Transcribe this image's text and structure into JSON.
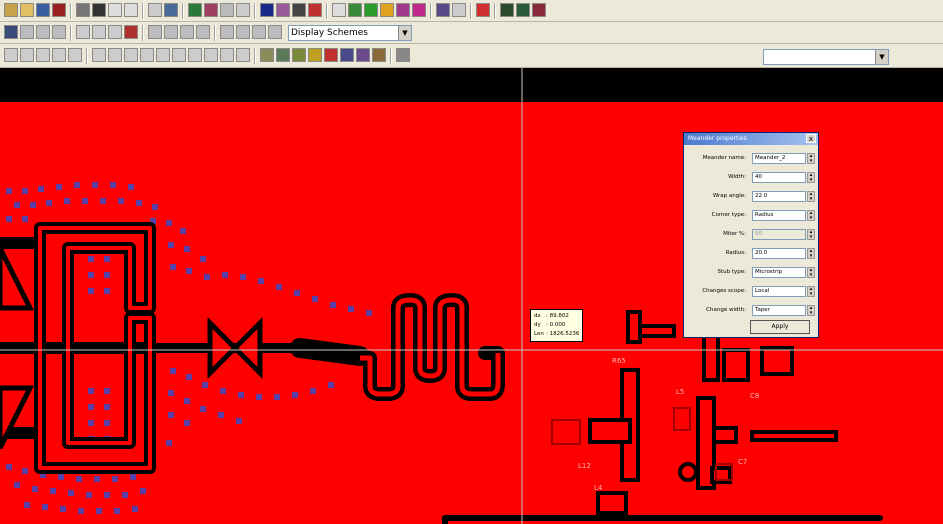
{
  "toolbar2": {
    "scheme_combo": "Display Schemes"
  },
  "toolbar3": {
    "right_combo": ""
  },
  "dialog": {
    "title": "Meander properties",
    "close_glyph": "x",
    "rows": [
      {
        "label": "Meander name:",
        "value": "Meander_2",
        "disabled": false
      },
      {
        "label": "Width:",
        "value": "40",
        "disabled": false
      },
      {
        "label": "Wrap angle:",
        "value": "22.0",
        "disabled": false
      },
      {
        "label": "Corner type:",
        "value": "Radius",
        "disabled": false
      },
      {
        "label": "Miter %:",
        "value": "50",
        "disabled": true
      },
      {
        "label": "Radius:",
        "value": "20.0",
        "disabled": false
      },
      {
        "label": "Stub type:",
        "value": "Microstrip",
        "disabled": false
      },
      {
        "label": "Changes scope:",
        "value": "Local",
        "disabled": false
      },
      {
        "label": "Change width:",
        "value": "Taper",
        "disabled": false
      }
    ],
    "apply_label": "Apply"
  },
  "readout": {
    "dx_label": "dx",
    "dx_value": ": 89.802",
    "dy_label": "dy",
    "dy_value": ": 0.000",
    "len_label": "Len",
    "len_value": ": 1826.5236"
  },
  "canvas_labels": [
    {
      "id": "label-r65",
      "text": "R65"
    },
    {
      "id": "label-l5",
      "text": "L5"
    },
    {
      "id": "label-c8",
      "text": "C8"
    },
    {
      "id": "label-c7",
      "text": "C7"
    },
    {
      "id": "label-l12",
      "text": "L12"
    },
    {
      "id": "label-l4",
      "text": "L4"
    }
  ],
  "colors": {
    "board": "#ff0000",
    "copper_outline": "#000000",
    "via": "#5b3fa8",
    "dialog_title": "#4a7bd0"
  }
}
